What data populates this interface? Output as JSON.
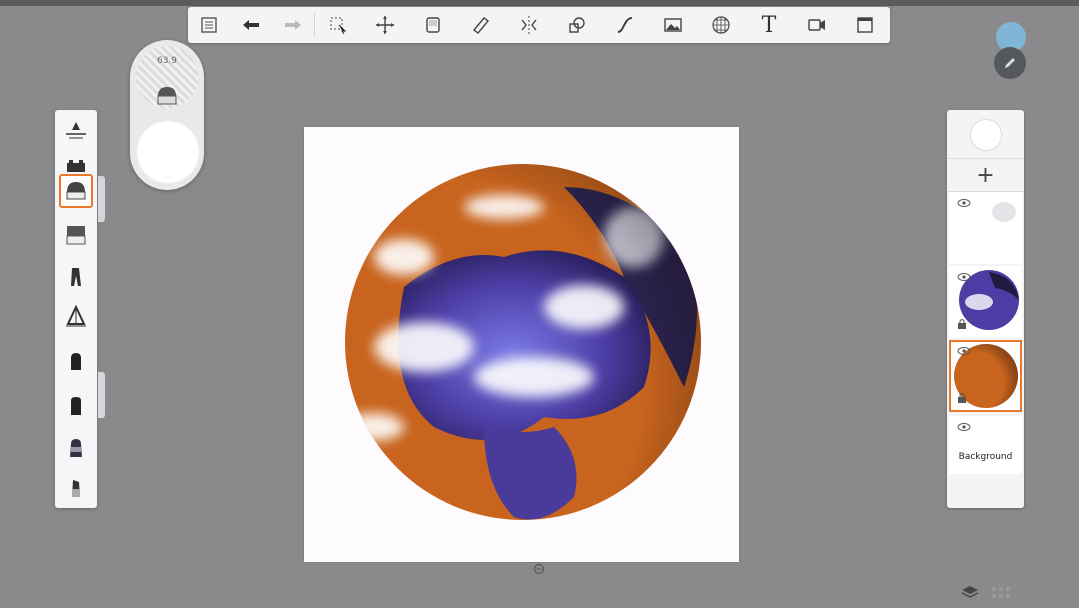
{
  "app": {
    "brush_size_readout": "63.9"
  },
  "toolbar": {
    "tools": [
      {
        "name": "gallery-icon"
      },
      {
        "name": "undo-icon"
      },
      {
        "name": "redo-icon"
      },
      {
        "name": "selection-icon"
      },
      {
        "name": "transform-icon"
      },
      {
        "name": "layer-fill-icon"
      },
      {
        "name": "ruler-icon"
      },
      {
        "name": "symmetry-icon"
      },
      {
        "name": "shapes-icon"
      },
      {
        "name": "curve-icon"
      },
      {
        "name": "image-import-icon"
      },
      {
        "name": "perspective-icon"
      },
      {
        "name": "text-icon"
      },
      {
        "name": "time-lapse-icon"
      },
      {
        "name": "fullscreen-icon"
      }
    ],
    "text_tool_glyph": "T"
  },
  "brushes": [
    {
      "name": "brush-1"
    },
    {
      "name": "brush-2"
    },
    {
      "name": "brush-3",
      "selected": true
    },
    {
      "name": "brush-4"
    },
    {
      "name": "brush-5"
    },
    {
      "name": "brush-6"
    },
    {
      "name": "brush-7"
    },
    {
      "name": "brush-8"
    },
    {
      "name": "brush-9"
    },
    {
      "name": "brush-10"
    }
  ],
  "layers": {
    "add_symbol": "+",
    "items": [
      {
        "name": "layer-clouds",
        "selected": false
      },
      {
        "name": "layer-earth-night",
        "selected": false
      },
      {
        "name": "layer-orange-base",
        "selected": true
      },
      {
        "name": "layer-background",
        "label": "Background",
        "selected": false
      }
    ]
  },
  "colors": {
    "accent": "#e8782a",
    "ocean": "#5b4fb8",
    "land": "#c8641e",
    "cloud": "#ffffff"
  }
}
